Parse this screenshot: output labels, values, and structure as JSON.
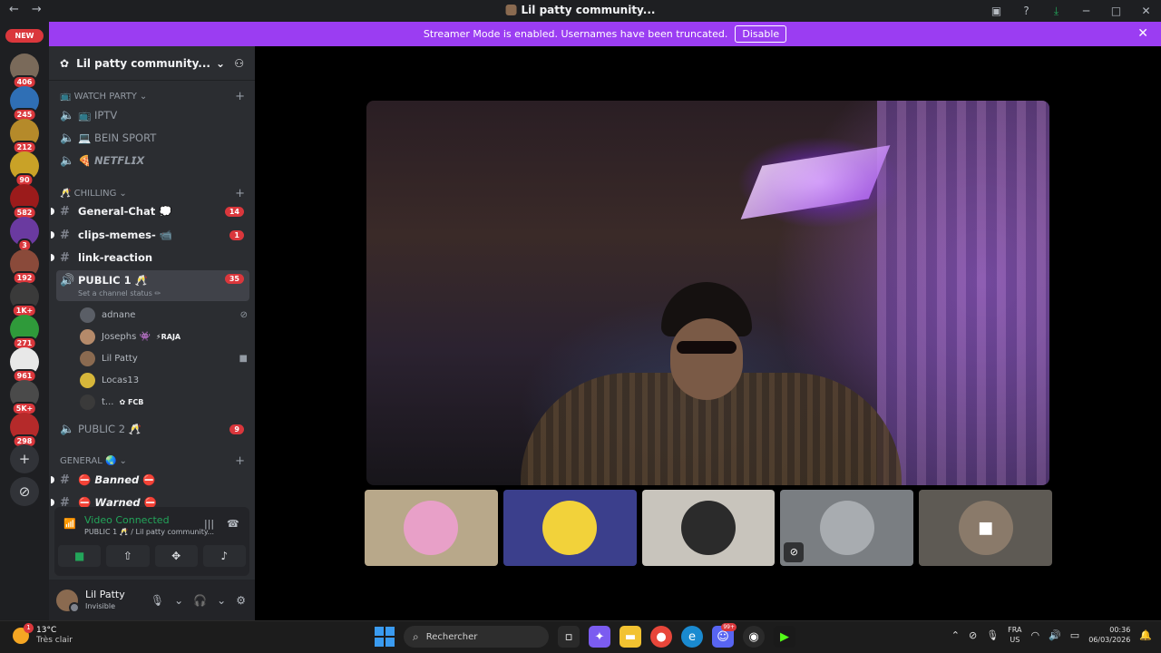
{
  "titlebar": {
    "back": "←",
    "forward": "→",
    "title": "Lil patty community..."
  },
  "banner": {
    "text": "Streamer Mode is enabled. Usernames have been truncated.",
    "button": "Disable"
  },
  "rail": {
    "new_label": "NEW",
    "servers": [
      {
        "badge": "406",
        "color": "#7a6a5a"
      },
      {
        "badge": "245",
        "color": "#2f6fb5"
      },
      {
        "badge": "212",
        "color": "#b58a2a"
      },
      {
        "badge": "90",
        "color": "#c9a227"
      },
      {
        "badge": "582",
        "color": "#9b1b1b"
      },
      {
        "badge": "3",
        "color": "#6a3aa0"
      },
      {
        "badge": "192",
        "color": "#8a4a3a"
      },
      {
        "badge": "1K+",
        "color": "#3a3a3a"
      },
      {
        "badge": "271",
        "color": "#2f9a3a"
      },
      {
        "badge": "961",
        "color": "#e8e8e8"
      },
      {
        "badge": "5K+",
        "color": "#4a4a4a"
      },
      {
        "badge": "298",
        "color": "#b52a2a"
      }
    ]
  },
  "sidebar": {
    "server_name": "Lil patty community...",
    "categories": [
      {
        "label": "📺 WATCH PARTY"
      },
      {
        "label": "🥂 CHILLING"
      },
      {
        "label": "GENERAL 🌏"
      }
    ],
    "watch_channels": [
      {
        "name": "📺 IPTV"
      },
      {
        "name": "💻 BEIN SPORT"
      },
      {
        "name": "🍕 𝙉𝙀𝙏𝙁𝙇𝙄𝙓"
      }
    ],
    "chill_channels": [
      {
        "name": "General-Chat 💭",
        "badge": "14"
      },
      {
        "name": "clips-memes- 📹",
        "badge": "1"
      },
      {
        "name": "link-reaction",
        "badge": ""
      }
    ],
    "active_voice": {
      "name": "PUBLIC 1 🥂",
      "badge": "35",
      "status": "Set a channel status ✏"
    },
    "voice_users": [
      {
        "name": "adnane",
        "tag": "",
        "color": "#5a5e66"
      },
      {
        "name": "Josephs 👾",
        "tag": "⚡RAJA",
        "color": "#b58a6a"
      },
      {
        "name": "Lil Patty",
        "tag": "",
        "color": "#8a6a50"
      },
      {
        "name": "Locas13",
        "tag": "",
        "color": "#d6b63a"
      },
      {
        "name": "t...",
        "tag": "✿ FCB",
        "color": "#3a3a3a"
      }
    ],
    "public2": {
      "name": "PUBLIC 2 🥂",
      "badge": "9"
    },
    "general_channels": [
      {
        "name": "⛔ 𝘽𝙖𝙣𝙣𝙚𝙙 ⛔"
      },
      {
        "name": "⛔ 𝙒𝙖𝙧𝙣𝙚𝙙 ⛔"
      }
    ]
  },
  "voice_panel": {
    "status": "Video Connected",
    "sub": "PUBLIC 1 🥂 / Lil patty community..."
  },
  "user": {
    "name": "Lil Patty",
    "status": "Invisible"
  },
  "tiles": [
    {
      "color": "#b8a88a",
      "avatar": "#e8a0c8"
    },
    {
      "color": "#3b3f8c",
      "avatar": "#f2d23a"
    },
    {
      "color": "#c8c4bc",
      "avatar": "#2b2b2b"
    },
    {
      "color": "#7a7e82",
      "avatar": "#a8acb0"
    },
    {
      "color": "#5e5a54",
      "avatar": "#8a7a6a"
    }
  ],
  "taskbar": {
    "temp": "13°C",
    "weather": "Très clair",
    "weather_badge": "1",
    "search": "Rechercher",
    "discord_badge": "99+",
    "lang1": "FRA",
    "lang2": "US",
    "time": "00:36",
    "date": "06/03/2026"
  }
}
